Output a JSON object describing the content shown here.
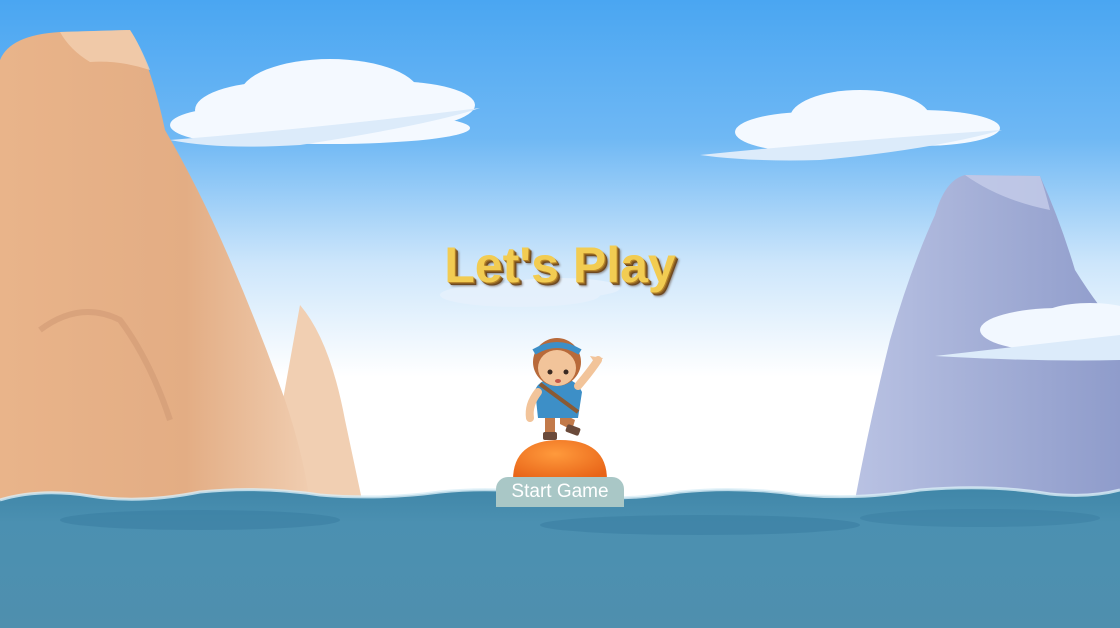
{
  "title": "Let's Play",
  "start_button": {
    "label": "Start Game"
  },
  "colors": {
    "sky_top": "#4aa6f2",
    "sky_horizon": "#ffffff",
    "sea": "#4a8fb0",
    "left_cliff": "#e7b48b",
    "right_cliff": "#a2afd4",
    "title_fill": "#f2cc52",
    "title_outline": "#8a5f22",
    "ball": "#f07a23",
    "button_bg": "#a9c7c6"
  },
  "icons": {
    "character": "explorer-girl",
    "ball": "orange-buoy"
  }
}
